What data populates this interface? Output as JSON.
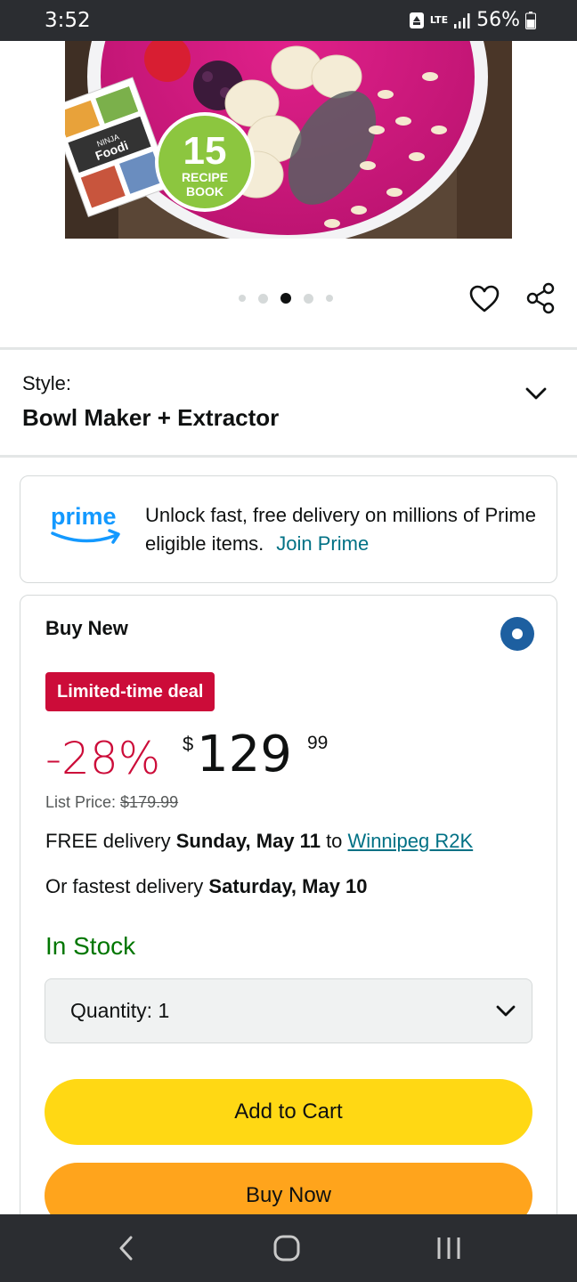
{
  "status_bar": {
    "time": "3:52",
    "network": "LTE",
    "battery": "56%"
  },
  "product_image": {
    "brand_on_book": "NINJA",
    "product_on_book": "Foodi",
    "badge_number": "15",
    "badge_line1": "RECIPE",
    "badge_line2": "BOOK"
  },
  "carousel": {
    "total": 5,
    "active_index": 2
  },
  "style": {
    "label": "Style:",
    "value": "Bowl Maker + Extractor"
  },
  "prime": {
    "logo_text": "prime",
    "message": "Unlock fast, free delivery on millions of Prime eligible items.",
    "link": "Join Prime"
  },
  "buy_box": {
    "title": "Buy New",
    "deal_badge": "Limited-time deal",
    "discount": "-28%",
    "currency": "$",
    "price_whole": "129",
    "price_fraction": "99",
    "list_price_label": "List Price:",
    "list_price": "$179.99",
    "delivery_prefix": "FREE delivery",
    "delivery_date": "Sunday, May 11",
    "delivery_to": "to",
    "delivery_location": "Winnipeg R2K",
    "fastest_prefix": "Or fastest delivery",
    "fastest_date": "Saturday, May 10",
    "stock_status": "In Stock",
    "quantity_label": "Quantity:",
    "quantity_value": "1",
    "add_to_cart": "Add to Cart",
    "buy_now": "Buy Now"
  },
  "colors": {
    "deal_red": "#cc0c39",
    "link_teal": "#007185",
    "in_stock_green": "#007600",
    "add_to_cart_yellow": "#ffd814",
    "buy_now_orange": "#ffa41c",
    "radio_blue": "#1d5fa0",
    "prime_blue": "#1399ff"
  },
  "icons": {
    "favorite": "heart-icon",
    "share": "share-icon",
    "back": "back-icon",
    "home": "home-icon",
    "recents": "recents-icon"
  }
}
